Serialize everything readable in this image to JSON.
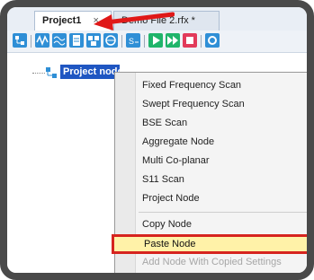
{
  "tabs": [
    {
      "label": "Project1",
      "close": "×"
    },
    {
      "label": "Demo File 2.rfx *"
    }
  ],
  "toolbar": {
    "icons": [
      "tree-icon",
      "sine-wave-icon",
      "swept-wave-icon",
      "document-icon",
      "aggregate-icon",
      "network-icon",
      "s11-icon",
      "play-icon",
      "fast-forward-icon",
      "stop-icon",
      "settings-icon"
    ]
  },
  "tree": {
    "root_label": "Project node"
  },
  "context_menu": {
    "items": [
      {
        "label": "Fixed Frequency Scan"
      },
      {
        "label": "Swept Frequency Scan"
      },
      {
        "label": "BSE Scan"
      },
      {
        "label": "Aggregate Node"
      },
      {
        "label": "Multi Co-planar"
      },
      {
        "label": "S11 Scan"
      },
      {
        "label": "Project Node"
      },
      {
        "label": "Copy Node"
      },
      {
        "label": "Paste Node"
      },
      {
        "label": "Add Node With Copied Settings"
      }
    ]
  },
  "colors": {
    "highlight_border": "#d6241f",
    "highlight_fill": "#fff2a8",
    "selection": "#1f56c2"
  }
}
